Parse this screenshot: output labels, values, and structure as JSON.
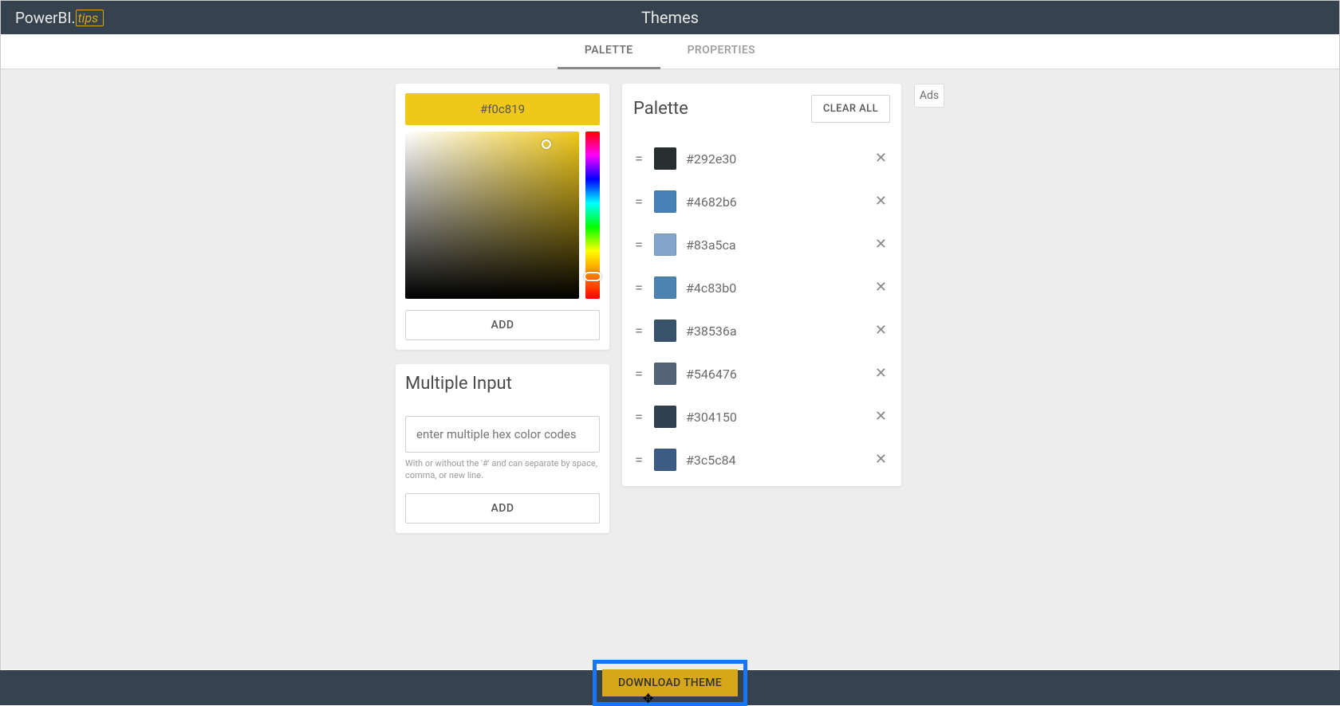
{
  "logo": {
    "prefix": "PowerBI.",
    "suffix": "tips"
  },
  "header": {
    "title": "Themes"
  },
  "tabs": [
    {
      "label": "PALETTE",
      "active": true
    },
    {
      "label": "PROPERTIES",
      "active": false
    }
  ],
  "picker": {
    "hex": "#f0c819",
    "add_label": "ADD"
  },
  "multi_input": {
    "title": "Multiple Input",
    "placeholder": "enter multiple hex color codes",
    "help": "With or without the '#' and can separate by space, comma, or new line.",
    "add_label": "ADD"
  },
  "palette": {
    "title": "Palette",
    "clear_label": "CLEAR ALL",
    "colors": [
      {
        "hex": "#292e30"
      },
      {
        "hex": "#4682b6"
      },
      {
        "hex": "#83a5ca"
      },
      {
        "hex": "#4c83b0"
      },
      {
        "hex": "#38536a"
      },
      {
        "hex": "#546476"
      },
      {
        "hex": "#304150"
      },
      {
        "hex": "#3c5c84"
      }
    ]
  },
  "ads": {
    "label": "Ads"
  },
  "download": {
    "label": "DOWNLOAD THEME"
  }
}
